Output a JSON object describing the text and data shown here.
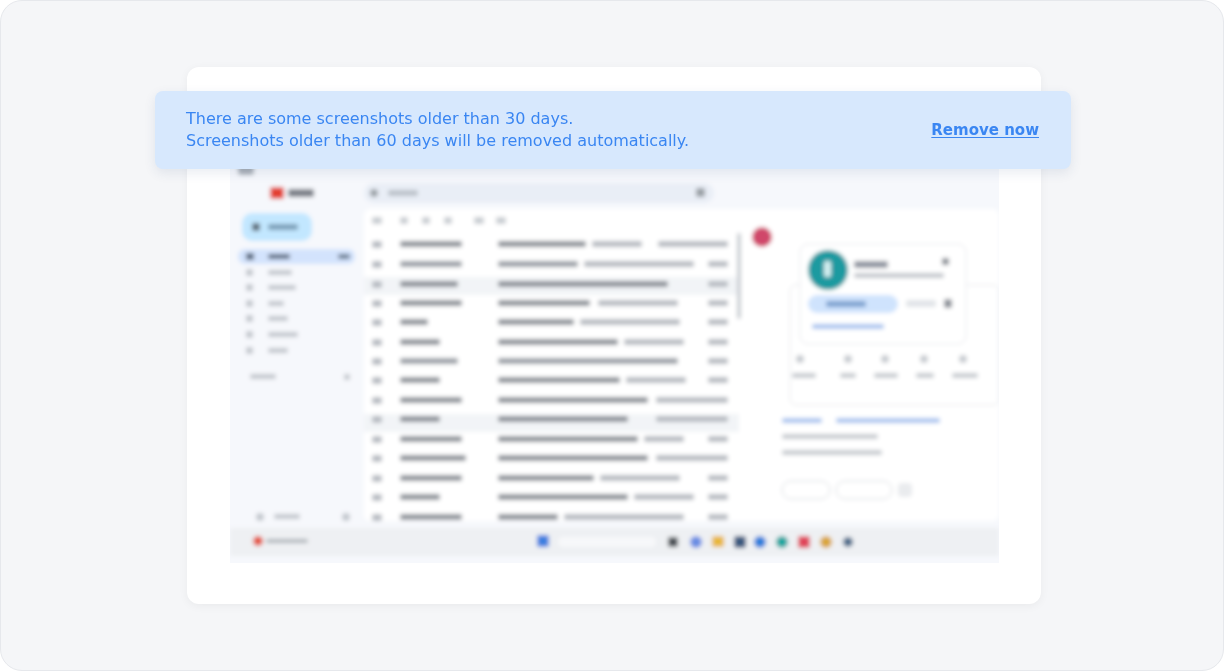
{
  "banner": {
    "lines": [
      "There are some screenshots older than 30 days.",
      "Screenshots older than 60 days will be removed automatically."
    ],
    "action": "Remove now"
  }
}
